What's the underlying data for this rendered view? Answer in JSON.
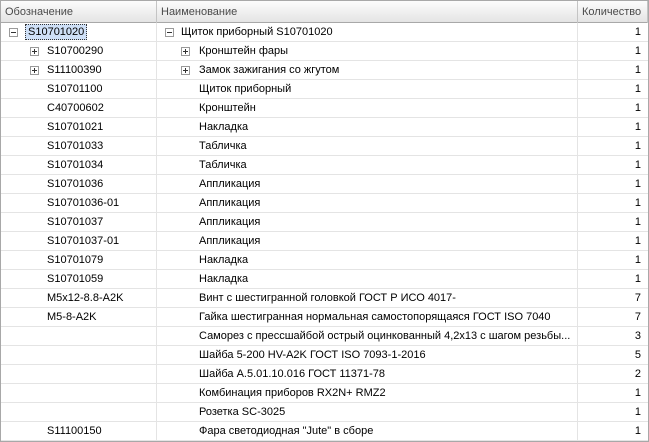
{
  "columns": {
    "designation": "Обозначение",
    "name": "Наименование",
    "quantity": "Количество"
  },
  "rows": [
    {
      "designation": "S10701020",
      "name": "Щиток приборный S10701020",
      "quantity": "1"
    },
    {
      "designation": "S10700290",
      "name": "Кронштейн фары",
      "quantity": "1"
    },
    {
      "designation": "S11100390",
      "name": "Замок зажигания со жгутом",
      "quantity": "1"
    },
    {
      "designation": "S10701100",
      "name": "Щиток приборный",
      "quantity": "1"
    },
    {
      "designation": "C40700602",
      "name": "Кронштейн",
      "quantity": "1"
    },
    {
      "designation": "S10701021",
      "name": "Накладка",
      "quantity": "1"
    },
    {
      "designation": "S10701033",
      "name": "Табличка",
      "quantity": "1"
    },
    {
      "designation": "S10701034",
      "name": "Табличка",
      "quantity": "1"
    },
    {
      "designation": "S10701036",
      "name": "Аппликация",
      "quantity": "1"
    },
    {
      "designation": "S10701036-01",
      "name": "Аппликация",
      "quantity": "1"
    },
    {
      "designation": "S10701037",
      "name": "Аппликация",
      "quantity": "1"
    },
    {
      "designation": "S10701037-01",
      "name": "Аппликация",
      "quantity": "1"
    },
    {
      "designation": "S10701079",
      "name": "Накладка",
      "quantity": "1"
    },
    {
      "designation": "S10701059",
      "name": "Накладка",
      "quantity": "1"
    },
    {
      "designation": "M5x12-8.8-A2K",
      "name": "Винт с шестигранной  головкой  ГОСТ  Р ИСО 4017-",
      "quantity": "7"
    },
    {
      "designation": "M5-8-A2K",
      "name": "Гайка шестигранная нормальная самостопорящаяся ГОСТ ISO 7040",
      "quantity": "7"
    },
    {
      "designation": "",
      "name": "Саморез с прессшайбой острый оцинкованный 4,2х13 с шагом резьбы...",
      "quantity": "3"
    },
    {
      "designation": "",
      "name": "Шайба 5-200 HV-A2K ГОСТ ISO 7093-1-2016",
      "quantity": "5"
    },
    {
      "designation": "",
      "name": "Шайба А.5.01.10.016 ГОСТ 11371-78",
      "quantity": "2"
    },
    {
      "designation": "",
      "name": "Комбинация приборов RX2N+ RMZ2",
      "quantity": "1"
    },
    {
      "designation": "",
      "name": "Розетка SC-3025",
      "quantity": "1"
    },
    {
      "designation": "S11100150",
      "name": "Фара светодиодная \"Jute\" в сборе",
      "quantity": "1"
    }
  ]
}
